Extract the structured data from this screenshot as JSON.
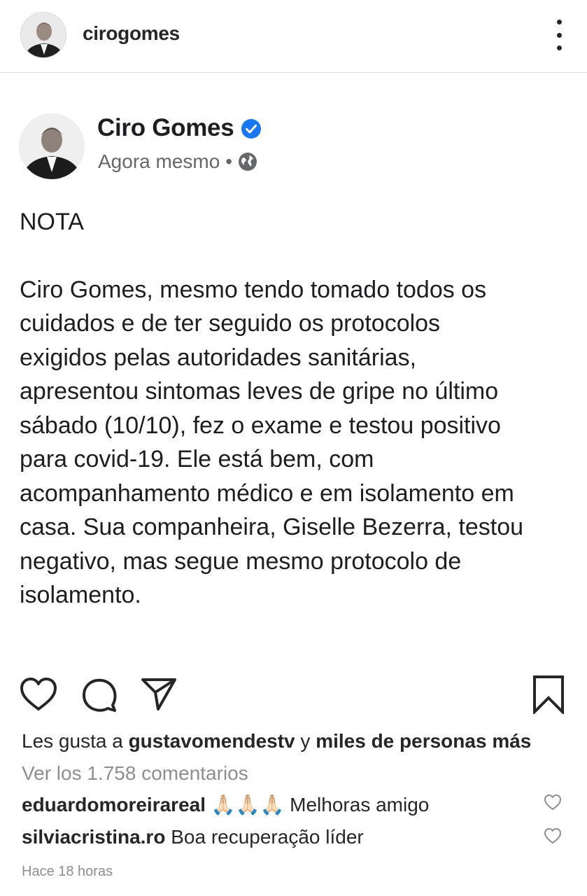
{
  "header": {
    "username": "cirogomes",
    "avatar_icon": "profile-photo",
    "more_icon": "more-options-icon"
  },
  "post": {
    "author": "Ciro Gomes",
    "verified_icon": "verified-badge-icon",
    "time": "Agora mesmo",
    "separator": "•",
    "privacy_icon": "globe-icon",
    "heading": "NOTA",
    "body": "Ciro Gomes, mesmo tendo tomado todos os\ncuidados e de ter seguido os protocolos\nexigidos pelas autoridades sanitárias,\napresentou sintomas leves de gripe no último\nsábado (10/10), fez o exame e testou positivo\npara covid-19. Ele está  bem, com\nacompanhamento médico e em isolamento em\ncasa. Sua companheira, Giselle Bezerra, testou\nnegativo, mas segue mesmo protocolo de\nisolamento."
  },
  "actions": {
    "icons": [
      "heart-icon",
      "comment-icon",
      "share-icon",
      "bookmark-icon"
    ]
  },
  "likes": {
    "prefix": "Les gusta a",
    "user": "gustavomendestv",
    "joiner": "y",
    "rest": "miles de personas más"
  },
  "view_comments": "Ver los 1.758 comentarios",
  "comments": [
    {
      "user": "eduardomoreirareal",
      "emoji": "🙏🏻🙏🏻🙏🏻",
      "text": "Melhoras amigo"
    },
    {
      "user": "silviacristina.ro",
      "text": "Boa  recuperação líder"
    }
  ],
  "timestamp": "Hace 18 horas",
  "colors": {
    "text": "#262626",
    "secondary": "#8e8e8e",
    "verified": "#1877f2",
    "divider": "#dbdbdb"
  }
}
